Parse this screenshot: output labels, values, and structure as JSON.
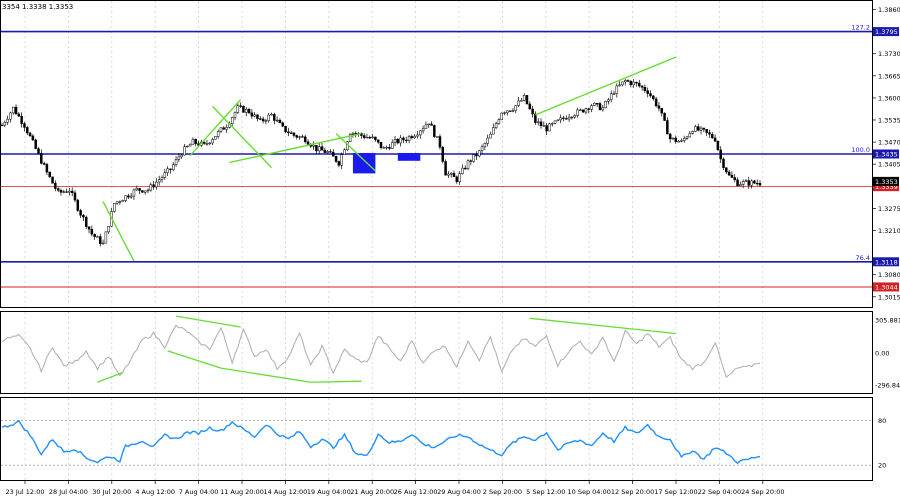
{
  "header": {
    "ohlc_text": "3354 1.3338 1.3353"
  },
  "colors": {
    "fib_line": "#1a1aad",
    "red_line": "#d42020",
    "trend": "#66dd33",
    "osc": "#b3b3b3",
    "rsi": "#1e90ff",
    "box": "#1a1af0",
    "candle": "#000000",
    "grid": "#c8c8c8"
  },
  "chart_data": {
    "type": "candlestick",
    "x_tick_labels": [
      "23 Jul 12:00",
      "28 Jul 04:00",
      "30 Jul 20:00",
      "4 Aug 12:00",
      "7 Aug 04:00",
      "11 Aug 20:00",
      "14 Aug 12:00",
      "19 Aug 04:00",
      "21 Aug 20:00",
      "26 Aug 12:00",
      "29 Aug 04:00",
      "2 Sep 20:00",
      "5 Sep 12:00",
      "10 Sep 04:00",
      "12 Sep 20:00",
      "17 Sep 12:00",
      "22 Sep 04:00",
      "24 Sep 20:00"
    ],
    "price_axis": {
      "ylim": [
        1.2985,
        1.3885
      ],
      "ticks": [
        "1.3860",
        "1.3730",
        "1.3665",
        "1.3600",
        "1.3535",
        "1.3470",
        "1.3405",
        "1.3275",
        "1.3210",
        "1.3080",
        "1.3015"
      ],
      "levels": [
        {
          "value": 1.3795,
          "badge": "1.3795",
          "label": "127.2",
          "kind": "fib"
        },
        {
          "value": 1.3435,
          "badge": "1.3435",
          "label": "100.0",
          "kind": "fib"
        },
        {
          "value": 1.3118,
          "badge": "1.3118",
          "label": "76.4",
          "kind": "fib"
        },
        {
          "value": 1.3044,
          "badge": "1.3044",
          "label": "",
          "kind": "red"
        }
      ],
      "current_price": {
        "value": 1.3353,
        "badge": "1.3353"
      },
      "bid_line": {
        "value": 1.3339,
        "badge": "1.3339"
      }
    },
    "candles": {
      "anchors": [
        [
          0,
          1.352
        ],
        [
          4,
          1.357
        ],
        [
          8,
          1.352
        ],
        [
          12,
          1.345
        ],
        [
          16,
          1.338
        ],
        [
          20,
          1.332
        ],
        [
          24,
          1.333
        ],
        [
          28,
          1.326
        ],
        [
          32,
          1.32
        ],
        [
          36,
          1.317
        ],
        [
          40,
          1.329
        ],
        [
          44,
          1.331
        ],
        [
          48,
          1.333
        ],
        [
          52,
          1.333
        ],
        [
          56,
          1.336
        ],
        [
          60,
          1.339
        ],
        [
          64,
          1.344
        ],
        [
          68,
          1.347
        ],
        [
          72,
          1.346
        ],
        [
          76,
          1.349
        ],
        [
          80,
          1.352
        ],
        [
          84,
          1.357
        ],
        [
          88,
          1.356
        ],
        [
          92,
          1.353
        ],
        [
          96,
          1.355
        ],
        [
          100,
          1.351
        ],
        [
          104,
          1.349
        ],
        [
          108,
          1.348
        ],
        [
          112,
          1.345
        ],
        [
          116,
          1.344
        ],
        [
          120,
          1.341
        ],
        [
          124,
          1.35
        ],
        [
          128,
          1.349
        ],
        [
          132,
          1.348
        ],
        [
          136,
          1.345
        ],
        [
          140,
          1.347
        ],
        [
          144,
          1.348
        ],
        [
          148,
          1.35
        ],
        [
          152,
          1.353
        ],
        [
          156,
          1.346
        ],
        [
          158,
          1.338
        ],
        [
          162,
          1.336
        ],
        [
          166,
          1.341
        ],
        [
          170,
          1.344
        ],
        [
          174,
          1.349
        ],
        [
          178,
          1.356
        ],
        [
          182,
          1.357
        ],
        [
          186,
          1.36
        ],
        [
          190,
          1.353
        ],
        [
          194,
          1.351
        ],
        [
          198,
          1.353
        ],
        [
          202,
          1.355
        ],
        [
          206,
          1.356
        ],
        [
          210,
          1.358
        ],
        [
          214,
          1.357
        ],
        [
          218,
          1.362
        ],
        [
          222,
          1.365
        ],
        [
          226,
          1.364
        ],
        [
          230,
          1.362
        ],
        [
          234,
          1.357
        ],
        [
          238,
          1.348
        ],
        [
          242,
          1.347
        ],
        [
          246,
          1.351
        ],
        [
          250,
          1.35
        ],
        [
          254,
          1.348
        ],
        [
          256,
          1.342
        ],
        [
          259,
          1.337
        ],
        [
          262,
          1.335
        ]
      ]
    },
    "trend_lines": [
      {
        "points": [
          [
            36,
            1.3295
          ],
          [
            47,
            1.312
          ]
        ]
      },
      {
        "points": [
          [
            75,
            1.3575
          ],
          [
            96,
            1.3395
          ]
        ]
      },
      {
        "points": [
          [
            67,
            1.343
          ],
          [
            85,
            1.3595
          ]
        ]
      },
      {
        "points": [
          [
            81,
            1.341
          ],
          [
            128,
            1.3495
          ]
        ]
      },
      {
        "points": [
          [
            119,
            1.3495
          ],
          [
            133,
            1.3385
          ]
        ]
      },
      {
        "points": [
          [
            190,
            1.355
          ],
          [
            240,
            1.372
          ]
        ]
      }
    ],
    "boxes": [
      {
        "x1": 125,
        "x2": 133,
        "y_top": 1.3438,
        "y_bottom": 1.3378
      },
      {
        "x1": 141,
        "x2": 149,
        "y_top": 1.3438,
        "y_bottom": 1.3415
      }
    ],
    "oscillator": {
      "ylim": [
        -360,
        360
      ],
      "ticks": [
        "305.8816",
        "0.00",
        "-296.8470"
      ],
      "anchors": [
        [
          0,
          120
        ],
        [
          6,
          160
        ],
        [
          10,
          40
        ],
        [
          14,
          -160
        ],
        [
          18,
          60
        ],
        [
          22,
          -120
        ],
        [
          26,
          -80
        ],
        [
          30,
          20
        ],
        [
          34,
          -140
        ],
        [
          38,
          -30
        ],
        [
          42,
          -220
        ],
        [
          46,
          -60
        ],
        [
          50,
          120
        ],
        [
          54,
          180
        ],
        [
          58,
          60
        ],
        [
          62,
          250
        ],
        [
          66,
          200
        ],
        [
          70,
          100
        ],
        [
          74,
          40
        ],
        [
          78,
          230
        ],
        [
          82,
          -80
        ],
        [
          86,
          210
        ],
        [
          90,
          -30
        ],
        [
          94,
          40
        ],
        [
          98,
          -140
        ],
        [
          102,
          -40
        ],
        [
          106,
          180
        ],
        [
          110,
          -120
        ],
        [
          114,
          60
        ],
        [
          118,
          -180
        ],
        [
          122,
          30
        ],
        [
          126,
          -60
        ],
        [
          130,
          -90
        ],
        [
          134,
          160
        ],
        [
          138,
          40
        ],
        [
          142,
          -80
        ],
        [
          146,
          120
        ],
        [
          150,
          -100
        ],
        [
          154,
          30
        ],
        [
          158,
          60
        ],
        [
          162,
          -130
        ],
        [
          166,
          120
        ],
        [
          170,
          -60
        ],
        [
          174,
          150
        ],
        [
          178,
          -180
        ],
        [
          182,
          40
        ],
        [
          186,
          130
        ],
        [
          190,
          60
        ],
        [
          194,
          160
        ],
        [
          198,
          -110
        ],
        [
          202,
          20
        ],
        [
          206,
          110
        ],
        [
          210,
          -20
        ],
        [
          214,
          150
        ],
        [
          218,
          -90
        ],
        [
          222,
          200
        ],
        [
          226,
          80
        ],
        [
          230,
          180
        ],
        [
          234,
          60
        ],
        [
          238,
          140
        ],
        [
          242,
          -60
        ],
        [
          246,
          -140
        ],
        [
          250,
          -90
        ],
        [
          254,
          100
        ],
        [
          258,
          -230
        ],
        [
          262,
          -140
        ],
        [
          266,
          -130
        ],
        [
          270,
          -80
        ]
      ]
    },
    "osc_trend_lines": [
      {
        "points": [
          [
            34,
            -270
          ],
          [
            43,
            -180
          ]
        ]
      },
      {
        "points": [
          [
            62,
            340
          ],
          [
            85,
            240
          ]
        ]
      },
      {
        "points": [
          [
            59,
            20
          ],
          [
            78,
            -140
          ]
        ]
      },
      {
        "points": [
          [
            78,
            -140
          ],
          [
            110,
            -270
          ]
        ]
      },
      {
        "points": [
          [
            110,
            -270
          ],
          [
            128,
            -260
          ]
        ]
      },
      {
        "points": [
          [
            188,
            320
          ],
          [
            240,
            180
          ]
        ]
      }
    ],
    "rsi": {
      "ylim": [
        0,
        110
      ],
      "ticks": [
        "80",
        "20"
      ],
      "levels": [
        80,
        20
      ],
      "anchors": [
        [
          0,
          70
        ],
        [
          6,
          78
        ],
        [
          10,
          60
        ],
        [
          14,
          35
        ],
        [
          18,
          55
        ],
        [
          22,
          38
        ],
        [
          26,
          42
        ],
        [
          30,
          30
        ],
        [
          34,
          24
        ],
        [
          38,
          32
        ],
        [
          42,
          26
        ],
        [
          44,
          45
        ],
        [
          50,
          53
        ],
        [
          54,
          44
        ],
        [
          58,
          60
        ],
        [
          62,
          55
        ],
        [
          66,
          64
        ],
        [
          70,
          63
        ],
        [
          74,
          70
        ],
        [
          78,
          66
        ],
        [
          82,
          78
        ],
        [
          86,
          68
        ],
        [
          90,
          58
        ],
        [
          94,
          75
        ],
        [
          98,
          62
        ],
        [
          102,
          55
        ],
        [
          106,
          65
        ],
        [
          110,
          45
        ],
        [
          114,
          55
        ],
        [
          118,
          44
        ],
        [
          122,
          60
        ],
        [
          126,
          36
        ],
        [
          130,
          32
        ],
        [
          134,
          62
        ],
        [
          138,
          50
        ],
        [
          142,
          52
        ],
        [
          146,
          62
        ],
        [
          150,
          48
        ],
        [
          154,
          44
        ],
        [
          158,
          52
        ],
        [
          162,
          60
        ],
        [
          166,
          58
        ],
        [
          170,
          48
        ],
        [
          174,
          40
        ],
        [
          178,
          34
        ],
        [
          182,
          50
        ],
        [
          186,
          58
        ],
        [
          190,
          54
        ],
        [
          194,
          64
        ],
        [
          198,
          40
        ],
        [
          202,
          50
        ],
        [
          206,
          53
        ],
        [
          210,
          46
        ],
        [
          214,
          63
        ],
        [
          218,
          52
        ],
        [
          222,
          70
        ],
        [
          226,
          62
        ],
        [
          230,
          74
        ],
        [
          234,
          58
        ],
        [
          238,
          55
        ],
        [
          242,
          30
        ],
        [
          246,
          40
        ],
        [
          250,
          28
        ],
        [
          254,
          44
        ],
        [
          258,
          36
        ],
        [
          262,
          24
        ],
        [
          266,
          28
        ],
        [
          270,
          32
        ]
      ]
    }
  }
}
